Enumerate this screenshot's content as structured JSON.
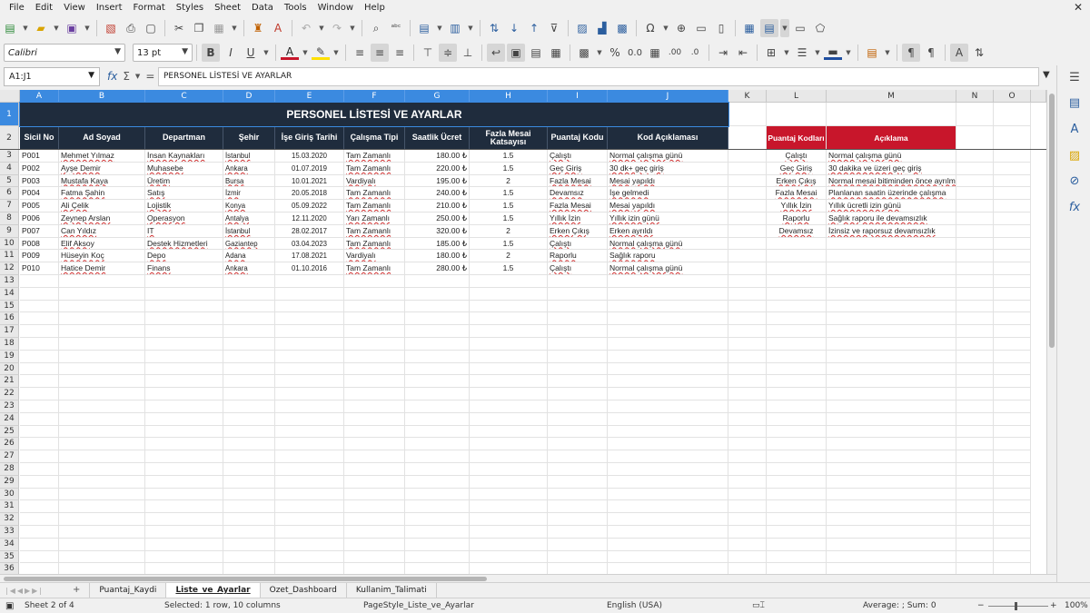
{
  "menu": [
    "File",
    "Edit",
    "View",
    "Insert",
    "Format",
    "Styles",
    "Sheet",
    "Data",
    "Tools",
    "Window",
    "Help"
  ],
  "toolbar": {
    "font_name": "Calibri",
    "font_size": "13 pt"
  },
  "formula_bar": {
    "name_box": "A1:J1",
    "content": "PERSONEL LİSTESİ VE AYARLAR"
  },
  "columns": [
    "A",
    "B",
    "C",
    "D",
    "E",
    "F",
    "G",
    "H",
    "I",
    "J",
    "K",
    "L",
    "M",
    "N",
    "O"
  ],
  "selected_columns": [
    "A",
    "B",
    "C",
    "D",
    "E",
    "F",
    "G",
    "H",
    "I",
    "J"
  ],
  "rows": [
    "1",
    "2",
    "3",
    "4",
    "5",
    "6",
    "7",
    "8",
    "9",
    "10",
    "11",
    "12",
    "13",
    "14",
    "15",
    "16",
    "17",
    "18",
    "19",
    "20",
    "21",
    "22",
    "23",
    "24",
    "25",
    "26",
    "27",
    "28",
    "29",
    "30",
    "31",
    "32",
    "33",
    "34",
    "35",
    "36"
  ],
  "sheet": {
    "title": "PERSONEL LİSTESİ VE AYARLAR",
    "headers": [
      "Sicil No",
      "Ad Soyad",
      "Departman",
      "Şehir",
      "İşe Giriş Tarihi",
      "Çalışma Tipi",
      "Saatlik Ücret",
      "Fazla Mesai Katsayısı",
      "Puantaj Kodu",
      "Kod Açıklaması"
    ],
    "rows": [
      [
        "P001",
        "Mehmet Yılmaz",
        "İnsan Kaynakları",
        "İstanbul",
        "15.03.2020",
        "Tam Zamanlı",
        "180.00 ₺",
        "1.5",
        "Çalıştı",
        "Normal çalışma günü"
      ],
      [
        "P002",
        "Ayşe Demir",
        "Muhasebe",
        "Ankara",
        "01.07.2019",
        "Tam Zamanlı",
        "220.00 ₺",
        "1.5",
        "Geç Giriş",
        "30 dk+ geç giriş"
      ],
      [
        "P003",
        "Mustafa Kaya",
        "Üretim",
        "Bursa",
        "10.01.2021",
        "Vardiyalı",
        "195.00 ₺",
        "2",
        "Fazla Mesai",
        "Mesai yapıldı"
      ],
      [
        "P004",
        "Fatma Şahin",
        "Satış",
        "İzmir",
        "20.05.2018",
        "Tam Zamanlı",
        "240.00 ₺",
        "1.5",
        "Devamsız",
        "İşe gelmedi"
      ],
      [
        "P005",
        "Ali Çelik",
        "Lojistik",
        "Konya",
        "05.09.2022",
        "Tam Zamanlı",
        "210.00 ₺",
        "1.5",
        "Fazla Mesai",
        "Mesai yapıldı"
      ],
      [
        "P006",
        "Zeynep Arslan",
        "Operasyon",
        "Antalya",
        "12.11.2020",
        "Yarı Zamanlı",
        "250.00 ₺",
        "1.5",
        "Yıllık İzin",
        "Yıllık izin günü"
      ],
      [
        "P007",
        "Can Yıldız",
        "IT",
        "İstanbul",
        "28.02.2017",
        "Tam Zamanlı",
        "320.00 ₺",
        "2",
        "Erken Çıkış",
        "Erken ayrıldı"
      ],
      [
        "P008",
        "Elif Aksoy",
        "Destek Hizmetleri",
        "Gaziantep",
        "03.04.2023",
        "Tam Zamanlı",
        "185.00 ₺",
        "1.5",
        "Çalıştı",
        "Normal çalışma günü"
      ],
      [
        "P009",
        "Hüseyin Koç",
        "Depo",
        "Adana",
        "17.08.2021",
        "Vardiyalı",
        "180.00 ₺",
        "2",
        "Raporlu",
        "Sağlık raporu"
      ],
      [
        "P010",
        "Hatice Demir",
        "Finans",
        "Ankara",
        "01.10.2016",
        "Tam Zamanlı",
        "280.00 ₺",
        "1.5",
        "Çalıştı",
        "Normal çalışma günü"
      ]
    ],
    "codes_headers": [
      "Puantaj Kodları",
      "Açıklama"
    ],
    "codes": [
      [
        "Çalıştı",
        "Normal çalışma günü"
      ],
      [
        "Geç Giriş",
        "30 dakika ve üzeri geç giriş"
      ],
      [
        "Erken Çıkış",
        "Normal mesai bitiminden önce ayrılma"
      ],
      [
        "Fazla Mesai",
        "Planlanan saatin üzerinde çalışma"
      ],
      [
        "Yıllık İzin",
        "Yıllık ücretli izin günü"
      ],
      [
        "Raporlu",
        "Sağlık raporu ile devamsızlık"
      ],
      [
        "Devamsız",
        "İzinsiz ve raporsuz devamsızlık"
      ]
    ]
  },
  "tabs": [
    "Puantaj_Kaydi",
    "Liste_ve_Ayarlar",
    "Ozet_Dashboard",
    "Kullanim_Talimati"
  ],
  "active_tab": "Liste_ve_Ayarlar",
  "tab_add": "+",
  "status": {
    "sheet": "Sheet 2 of 4",
    "selection": "Selected: 1 row, 10 columns",
    "page_style": "PageStyle_Liste_ve_Ayarlar",
    "language": "English (USA)",
    "summary": "Average: ; Sum: 0",
    "zoom": "100%"
  },
  "colors": {
    "header_navy": "#1f2c3d",
    "codes_red": "#c8162b",
    "selection_blue": "#3b8ae0"
  }
}
